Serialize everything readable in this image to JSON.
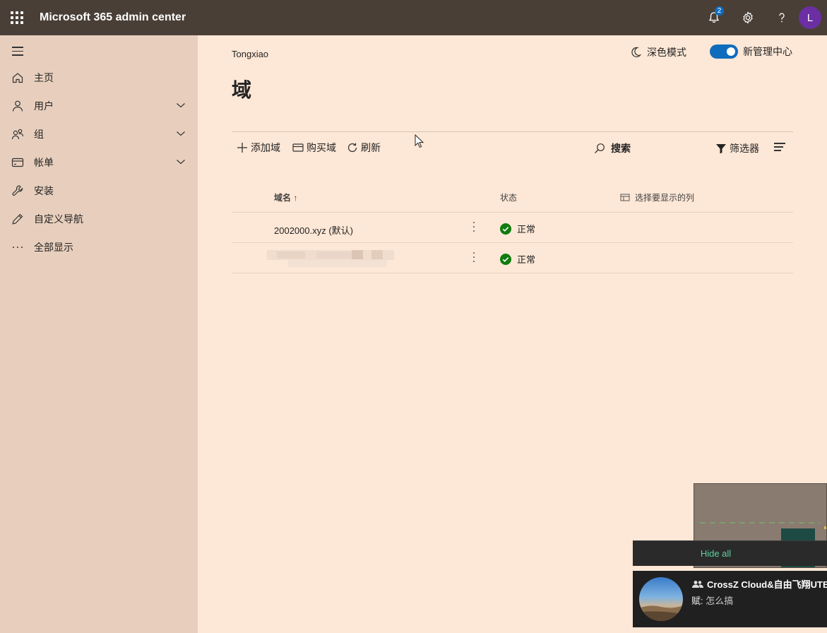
{
  "app": {
    "title": "Microsoft 365 admin center"
  },
  "topbar": {
    "notifications_count": "2",
    "avatar_initial": "L"
  },
  "sidebar": {
    "items": [
      {
        "label": "主页",
        "icon": "home-icon",
        "has_chevron": false
      },
      {
        "label": "用户",
        "icon": "person-icon",
        "has_chevron": true
      },
      {
        "label": "组",
        "icon": "people-icon",
        "has_chevron": true
      },
      {
        "label": "帐单",
        "icon": "credit-card-icon",
        "has_chevron": true
      },
      {
        "label": "安装",
        "icon": "wrench-icon",
        "has_chevron": false
      },
      {
        "label": "自定义导航",
        "icon": "pencil-icon",
        "has_chevron": false
      },
      {
        "label": "全部显示",
        "icon": "ellipsis-icon",
        "has_chevron": false
      }
    ]
  },
  "header": {
    "org_name": "Tongxiao",
    "dark_mode_label": "深色模式",
    "new_admin_label": "新管理中心",
    "new_admin_enabled": true,
    "page_title": "域"
  },
  "commands": {
    "add_domain": "添加域",
    "buy_domain": "购买域",
    "refresh": "刷新",
    "search": "搜索",
    "filter": "筛选器"
  },
  "table": {
    "columns": {
      "domain_name": "域名 ↑",
      "status": "状态",
      "choose_columns": "选择要显示的列"
    },
    "rows": [
      {
        "domain": "2002000.xyz (默认)",
        "status": "正常",
        "redacted": false
      },
      {
        "domain": "",
        "status": "正常",
        "redacted": true
      }
    ]
  },
  "overlay": {
    "hide_all": "Hide all",
    "notification": {
      "group_name": "CrossZ Cloud&自由飞翔UTB...",
      "sender": "赋:",
      "message": " 怎么搞"
    }
  },
  "colors": {
    "topbar": "#4a3f37",
    "sidebar": "#e8cfbd",
    "main": "#fde7d6",
    "accent": "#0f6cbd",
    "status_ok": "#107c10"
  }
}
